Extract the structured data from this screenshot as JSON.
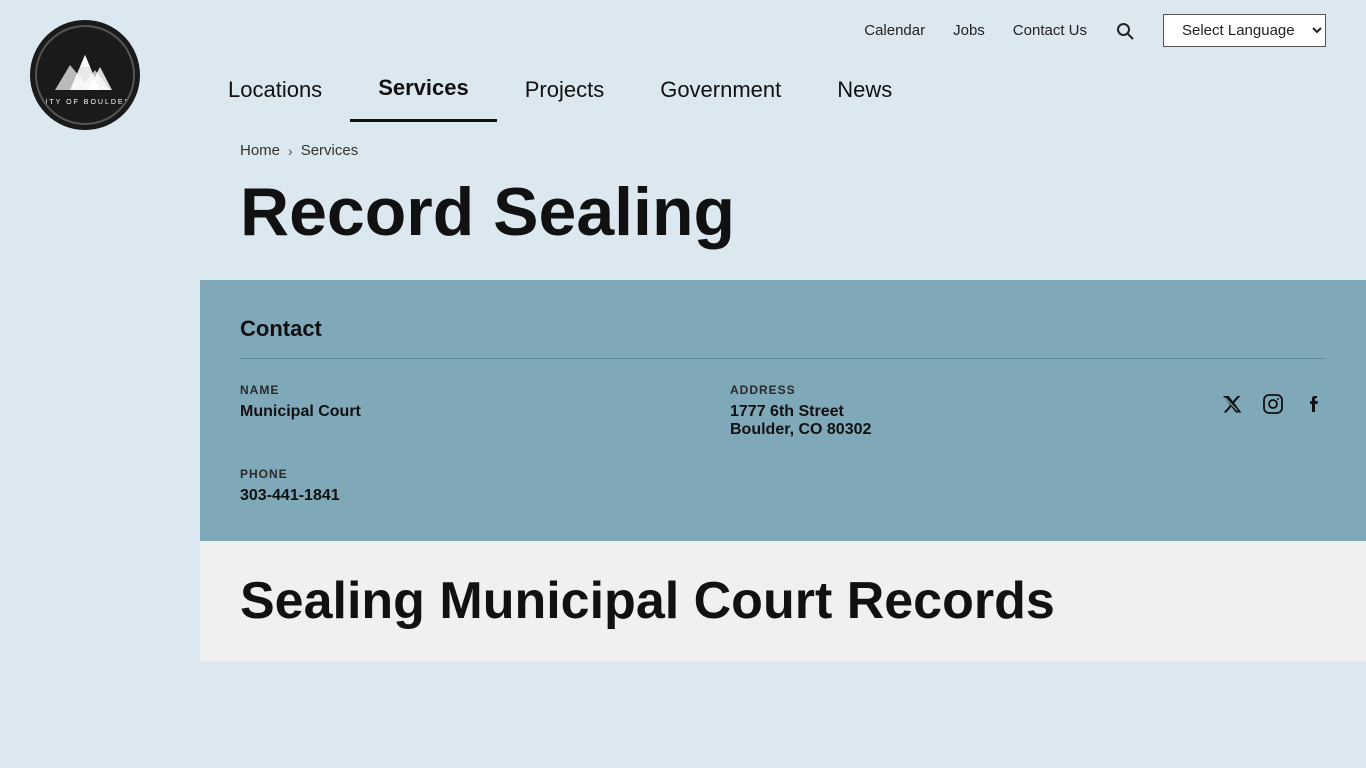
{
  "header": {
    "logo_alt": "City of Boulder",
    "logo_city_text": "CITY OF BOULDER",
    "top_links": [
      {
        "id": "calendar",
        "label": "Calendar"
      },
      {
        "id": "jobs",
        "label": "Jobs"
      },
      {
        "id": "contact",
        "label": "Contact Us"
      }
    ],
    "language_select": "Select Language",
    "nav_items": [
      {
        "id": "locations",
        "label": "Locations",
        "active": false
      },
      {
        "id": "services",
        "label": "Services",
        "active": true
      },
      {
        "id": "projects",
        "label": "Projects",
        "active": false
      },
      {
        "id": "government",
        "label": "Government",
        "active": false
      },
      {
        "id": "news",
        "label": "News",
        "active": false
      }
    ]
  },
  "breadcrumb": {
    "home_label": "Home",
    "separator": "›",
    "current_label": "Services"
  },
  "page": {
    "title": "Record Sealing"
  },
  "contact_card": {
    "section_title": "Contact",
    "name_label": "NAME",
    "name_value": "Municipal Court",
    "address_label": "ADDRESS",
    "address_line1": "1777 6th Street",
    "address_line2": "Boulder, CO 80302",
    "phone_label": "PHONE",
    "phone_value": "303-441-1841"
  },
  "social": {
    "twitter_symbol": "𝕏",
    "instagram_symbol": "📷",
    "facebook_symbol": "f"
  },
  "bottom": {
    "partial_title": "Sealing Municipal Court Records"
  }
}
